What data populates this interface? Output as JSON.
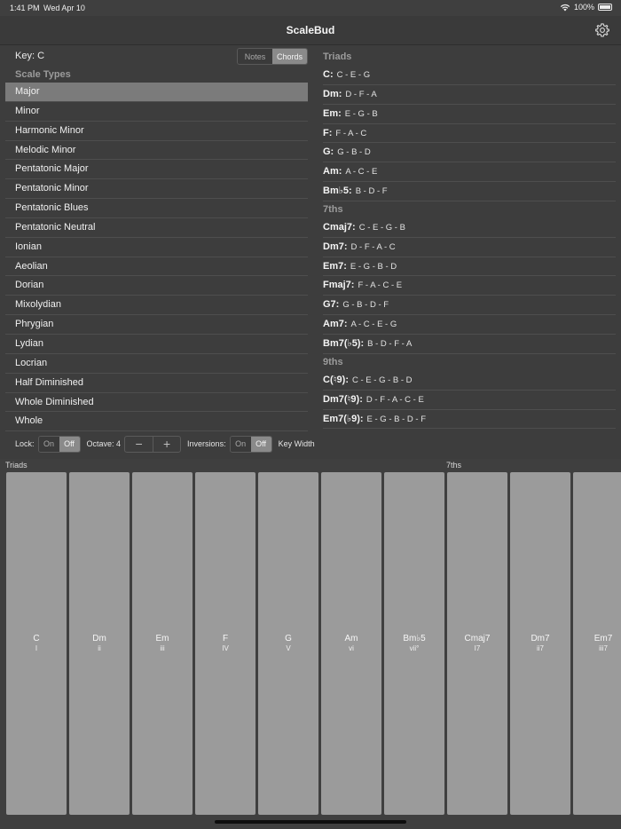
{
  "status": {
    "time": "1:41 PM",
    "date": "Wed Apr 10",
    "battery": "100%"
  },
  "nav": {
    "title": "ScaleBud",
    "settings_icon": "gear-icon"
  },
  "key_label": "Key: C",
  "view_toggle": {
    "options": [
      "Notes",
      "Chords"
    ],
    "selected": "Chords"
  },
  "scale_types": {
    "header": "Scale Types",
    "selected": "Major",
    "items": [
      "Major",
      "Minor",
      "Harmonic Minor",
      "Melodic Minor",
      "Pentatonic Major",
      "Pentatonic Minor",
      "Pentatonic Blues",
      "Pentatonic Neutral",
      "Ionian",
      "Aeolian",
      "Dorian",
      "Mixolydian",
      "Phrygian",
      "Lydian",
      "Locrian",
      "Half Diminished",
      "Whole Diminished",
      "Whole"
    ]
  },
  "chord_sections": [
    {
      "header": "Triads",
      "rows": [
        {
          "name": "C:",
          "notes": "C - E - G"
        },
        {
          "name": "Dm:",
          "notes": "D - F - A"
        },
        {
          "name": "Em:",
          "notes": "E - G - B"
        },
        {
          "name": "F:",
          "notes": "F - A - C"
        },
        {
          "name": "G:",
          "notes": "G - B - D"
        },
        {
          "name": "Am:",
          "notes": "A - C - E"
        },
        {
          "name": "Bm♭5:",
          "notes": "B - D - F"
        }
      ]
    },
    {
      "header": "7ths",
      "rows": [
        {
          "name": "Cmaj7:",
          "notes": "C - E - G - B"
        },
        {
          "name": "Dm7:",
          "notes": "D - F - A - C"
        },
        {
          "name": "Em7:",
          "notes": "E - G - B - D"
        },
        {
          "name": "Fmaj7:",
          "notes": "F - A - C - E"
        },
        {
          "name": "G7:",
          "notes": "G - B - D - F"
        },
        {
          "name": "Am7:",
          "notes": "A - C - E - G"
        },
        {
          "name": "Bm7(♭5):",
          "notes": "B - D - F - A"
        }
      ]
    },
    {
      "header": "9ths",
      "rows": [
        {
          "name": "C(♮9):",
          "notes": "C - E - G - B - D"
        },
        {
          "name": "Dm7(♮9):",
          "notes": "D - F - A - C - E"
        },
        {
          "name": "Em7(♭9):",
          "notes": "E - G - B - D - F"
        }
      ]
    }
  ],
  "controls": {
    "lock_label": "Lock:",
    "lock_options": [
      "On",
      "Off"
    ],
    "lock_selected": "Off",
    "octave_label": "Octave: 4",
    "stepper_minus": "−",
    "stepper_plus": "+",
    "inversions_label": "Inversions:",
    "inversions_options": [
      "On",
      "Off"
    ],
    "inversions_selected": "Off",
    "key_width_label": "Key Width"
  },
  "keyboard": {
    "groups": [
      {
        "label": "Triads",
        "start_index": 0
      },
      {
        "label": "7ths",
        "start_index": 7
      }
    ],
    "keys": [
      {
        "name": "C",
        "degree": "I"
      },
      {
        "name": "Dm",
        "degree": "ii"
      },
      {
        "name": "Em",
        "degree": "iii"
      },
      {
        "name": "F",
        "degree": "IV"
      },
      {
        "name": "G",
        "degree": "V"
      },
      {
        "name": "Am",
        "degree": "vi"
      },
      {
        "name": "Bm♭5",
        "degree": "vii°"
      },
      {
        "name": "Cmaj7",
        "degree": "I7"
      },
      {
        "name": "Dm7",
        "degree": "ii7"
      },
      {
        "name": "Em7",
        "degree": "iii7"
      }
    ]
  }
}
